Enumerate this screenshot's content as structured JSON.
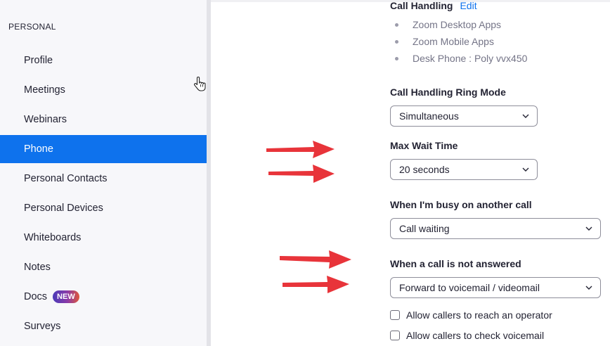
{
  "sidebar": {
    "section_label": "PERSONAL",
    "items": [
      {
        "label": "Profile"
      },
      {
        "label": "Meetings"
      },
      {
        "label": "Webinars"
      },
      {
        "label": "Phone"
      },
      {
        "label": "Personal Contacts"
      },
      {
        "label": "Personal Devices"
      },
      {
        "label": "Whiteboards"
      },
      {
        "label": "Notes"
      },
      {
        "label": "Docs",
        "badge": "NEW"
      },
      {
        "label": "Surveys"
      }
    ],
    "active_item": "Phone"
  },
  "call_handling": {
    "title": "Call Handling",
    "edit_label": "Edit",
    "devices": [
      "Zoom Desktop Apps",
      "Zoom Mobile Apps",
      "Desk Phone : Poly vvx450"
    ]
  },
  "ring_mode": {
    "label": "Call Handling Ring Mode",
    "value": "Simultaneous"
  },
  "max_wait": {
    "label": "Max Wait Time",
    "value": "20 seconds"
  },
  "busy": {
    "label": "When I'm busy on another call",
    "value": "Call waiting"
  },
  "not_answered": {
    "label": "When a call is not answered",
    "value": "Forward to voicemail / videomail"
  },
  "options": [
    {
      "label": "Allow callers to reach an operator",
      "checked": false
    },
    {
      "label": "Allow callers to check voicemail",
      "checked": false
    }
  ],
  "colors": {
    "accent": "#0e72ed",
    "annotation_arrow": "#e8343a"
  },
  "icons": [
    "hand-cursor-icon",
    "chevron-down-icon",
    "red-arrow-annotation-icon"
  ]
}
